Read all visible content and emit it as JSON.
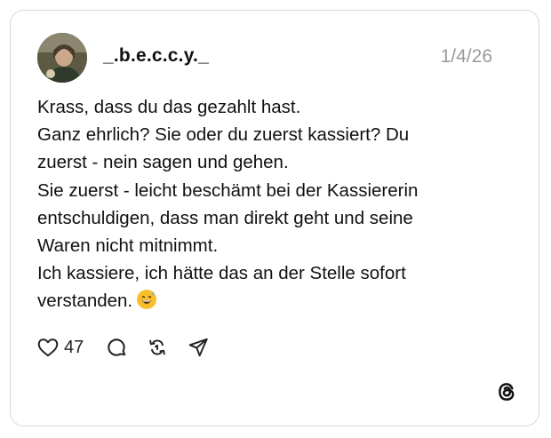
{
  "post": {
    "username": "_.b.e.c.c.y._",
    "date": "1/4/26",
    "lines": [
      "Krass, dass du das gezahlt hast.",
      "Ganz ehrlich? Sie oder du zuerst kassiert? Du",
      "zuerst - nein sagen und gehen.",
      "Sie zuerst - leicht beschämt bei der Kassiererin",
      "entschuldigen, dass man direkt geht und seine",
      "Waren nicht mitnimmt.",
      "Ich kassiere, ich hätte das an der Stelle sofort",
      "verstanden."
    ],
    "trailing_emoji": "grinning-face-with-sweat-emoji"
  },
  "actions": {
    "like_count": "47",
    "icons": [
      "heart-icon",
      "comment-icon",
      "repost-icon",
      "share-icon"
    ]
  },
  "branding": {
    "logo": "threads-logo-icon"
  },
  "colors": {
    "text": "#111111",
    "muted": "#9a9a9a",
    "border": "#d9d9d9",
    "emoji": "#f7c02b"
  }
}
